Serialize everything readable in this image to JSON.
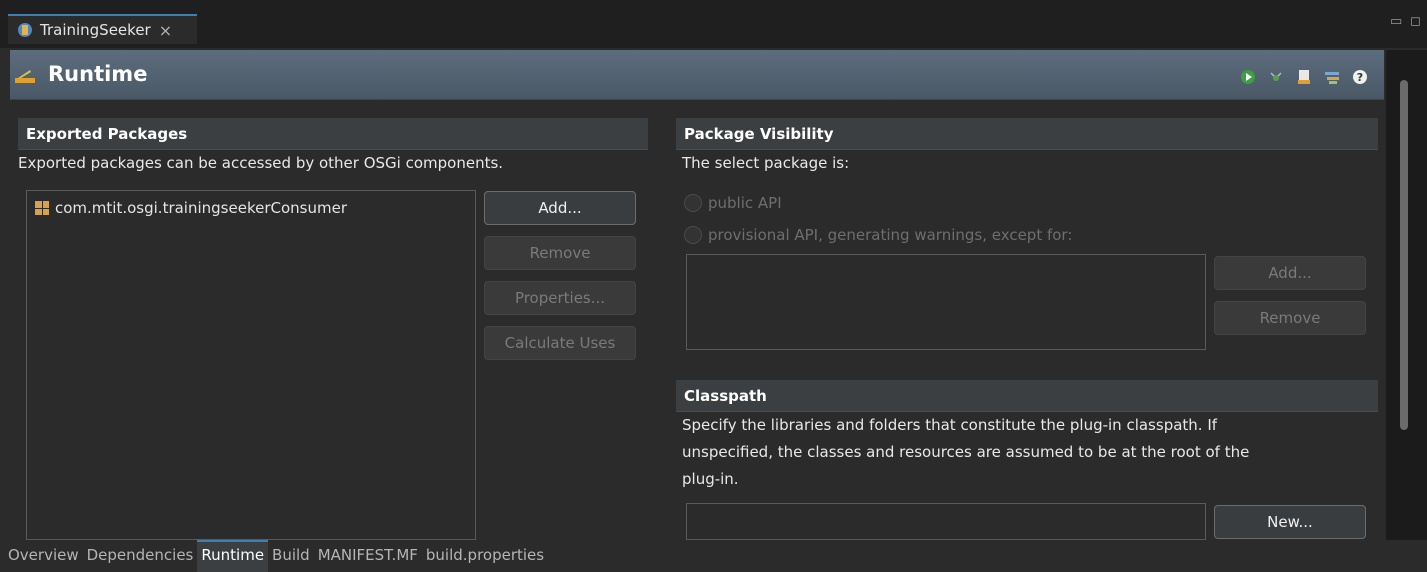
{
  "editor": {
    "tab_title": "TrainingSeeker",
    "close_glyph": "×",
    "minimize_glyph": "▭",
    "maximize_glyph": "◻"
  },
  "header": {
    "title": "Runtime",
    "tools": [
      "run-icon",
      "debug-icon",
      "export-icon",
      "settings-icon",
      "help-icon"
    ]
  },
  "exported_packages": {
    "title": "Exported Packages",
    "description": "Exported packages can be accessed by other OSGi components.",
    "items": [
      "com.mtit.osgi.trainingseekerConsumer"
    ],
    "buttons": {
      "add": "Add...",
      "remove": "Remove",
      "properties": "Properties...",
      "calculate_uses": "Calculate Uses"
    }
  },
  "package_visibility": {
    "title": "Package Visibility",
    "description": "The select package is:",
    "option_public": "public API",
    "option_provisional": "provisional API, generating warnings, except for:",
    "buttons": {
      "add": "Add...",
      "remove": "Remove"
    }
  },
  "classpath": {
    "title": "Classpath",
    "description_line1": "Specify the libraries and folders that constitute the plug-in classpath.  If",
    "description_line2": "unspecified, the classes and resources are assumed to be at the root of the",
    "description_line3": "plug-in.",
    "buttons": {
      "new": "New..."
    }
  },
  "page_tabs": [
    "Overview",
    "Dependencies",
    "Runtime",
    "Build",
    "MANIFEST.MF",
    "build.properties"
  ],
  "active_page_tab": "Runtime",
  "colors": {
    "accent": "#3c7fb1",
    "header_bg": "#56677a"
  }
}
